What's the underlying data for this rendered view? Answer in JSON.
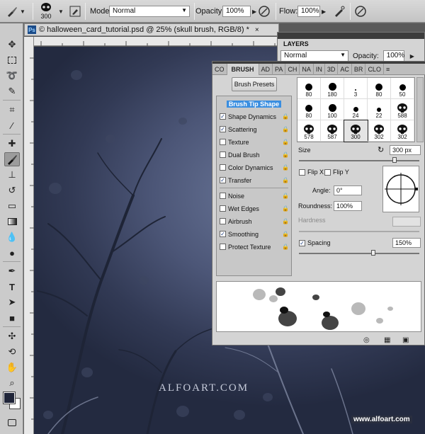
{
  "options_bar": {
    "brush_size": "300",
    "mode_label": "Mode:",
    "mode_value": "Normal",
    "opacity_label": "Opacity:",
    "opacity_value": "100%",
    "flow_label": "Flow:",
    "flow_value": "100%"
  },
  "document": {
    "badge": "Ps",
    "title": "© halloween_card_tutorial.psd @ 25% (skull brush, RGB/8) *",
    "watermark": "ALFOART.COM",
    "site_url": "www.alfoart.com"
  },
  "layers_panel": {
    "tab": "LAYERS",
    "blend_mode": "Normal",
    "opacity_label": "Opacity:",
    "opacity_value": "100%"
  },
  "brush_panel": {
    "tabs": [
      "CO",
      "BRUSH",
      "AD",
      "PA",
      "CH",
      "NA",
      "IN",
      "3D",
      "AC",
      "BR",
      "CLO"
    ],
    "presets_button": "Brush Presets",
    "options": [
      {
        "label": "Brush Tip Shape",
        "checked": null,
        "header": true
      },
      {
        "label": "Shape Dynamics",
        "checked": true
      },
      {
        "label": "Scattering",
        "checked": true
      },
      {
        "label": "Texture",
        "checked": false
      },
      {
        "label": "Dual Brush",
        "checked": false
      },
      {
        "label": "Color Dynamics",
        "checked": false
      },
      {
        "label": "Transfer",
        "checked": true
      },
      {
        "label": "Noise",
        "checked": false
      },
      {
        "label": "Wet Edges",
        "checked": false
      },
      {
        "label": "Airbrush",
        "checked": false
      },
      {
        "label": "Smoothing",
        "checked": true
      },
      {
        "label": "Protect Texture",
        "checked": false
      }
    ],
    "tips": [
      {
        "value": "80",
        "shape": "dot"
      },
      {
        "value": "180",
        "shape": "dot"
      },
      {
        "value": "3",
        "shape": "dot"
      },
      {
        "value": "80",
        "shape": "dot"
      },
      {
        "value": "50",
        "shape": "dot"
      },
      {
        "value": "80",
        "shape": "dot"
      },
      {
        "value": "100",
        "shape": "dot"
      },
      {
        "value": "24",
        "shape": "dot"
      },
      {
        "value": "22",
        "shape": "dot"
      },
      {
        "value": "588",
        "shape": "skull"
      },
      {
        "value": "578",
        "shape": "skull"
      },
      {
        "value": "587",
        "shape": "skull"
      },
      {
        "value": "300",
        "shape": "skull"
      },
      {
        "value": "302",
        "shape": "skull"
      },
      {
        "value": "302",
        "shape": "skull"
      }
    ],
    "size_label": "Size",
    "size_value": "300 px",
    "flip_x": "Flip X",
    "flip_y": "Flip Y",
    "angle_label": "Angle:",
    "angle_value": "0°",
    "roundness_label": "Roundness:",
    "roundness_value": "100%",
    "hardness_label": "Hardness",
    "spacing_label": "Spacing",
    "spacing_value": "150%",
    "spacing_checked": true
  }
}
